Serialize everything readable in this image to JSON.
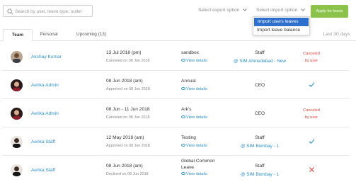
{
  "search": {
    "placeholder": "Search by user, leave type, outlet",
    "icon": "search-icon"
  },
  "toolbar": {
    "export_label": "Select export option",
    "import_label": "Select import option",
    "apply_label": "Apply for leave",
    "accent_color": "#8bc34a"
  },
  "import_dropdown": {
    "items": [
      {
        "label": "Import users leaves",
        "selected": true
      },
      {
        "label": "Import leave balance",
        "selected": false
      }
    ],
    "highlight_color": "#2d6fcc"
  },
  "tabs": [
    {
      "label": "Team",
      "active": true
    },
    {
      "label": "Personal",
      "active": false
    },
    {
      "label": "Upcoming (13)",
      "active": false
    }
  ],
  "range_label": "Last 30 days",
  "view_details_label": "View details",
  "rows": [
    {
      "name": "Akshay Kumar",
      "date": "13 Jul 2018 (pm)",
      "status": "Canceled on 08 Jun 2018",
      "leave_type": "sandbox",
      "role": "Staff",
      "location": "@ SIM Ahmedabad - New",
      "state_line1": "Canceled",
      "state_line2": "by user",
      "state": "canceled"
    },
    {
      "name": "Aerika Admin",
      "date": "08 Jun 2018 (am)",
      "status": "Approved on 08 Jun 2018",
      "leave_type": "Annual",
      "role": "CEO",
      "location": "",
      "state_line1": "",
      "state_line2": "",
      "state": "approved"
    },
    {
      "name": "Aerika Admin",
      "date": "08 Jun - 11 Jun 2018",
      "status": "Canceled on 08 Jun 2018",
      "leave_type": "Ark's",
      "role": "CEO",
      "location": "",
      "state_line1": "Canceled",
      "state_line2": "by user",
      "state": "canceled"
    },
    {
      "name": "Aerika Staff",
      "date": "12 May 2018 (am)",
      "status": "Approved on 08 Jun 2018",
      "leave_type": "Testing",
      "role": "Staff",
      "location": "@ SIM Bombay - 1",
      "state_line1": "",
      "state_line2": "",
      "state": "approved"
    },
    {
      "name": "Aerika Staff",
      "date": "08 Jun 2018 (am)",
      "status": "Declined on 08 Jun 2018",
      "leave_type_line1": "Global Common",
      "leave_type_line2": "Leave",
      "role": "Staff",
      "location": "@ SIM Bombay - 1",
      "state_line1": "",
      "state_line2": "",
      "state": "declined"
    }
  ],
  "colors": {
    "link": "#2b8fc7",
    "approved": "#2b8fc7",
    "canceled": "#e0443c",
    "declined": "#e0443c"
  }
}
